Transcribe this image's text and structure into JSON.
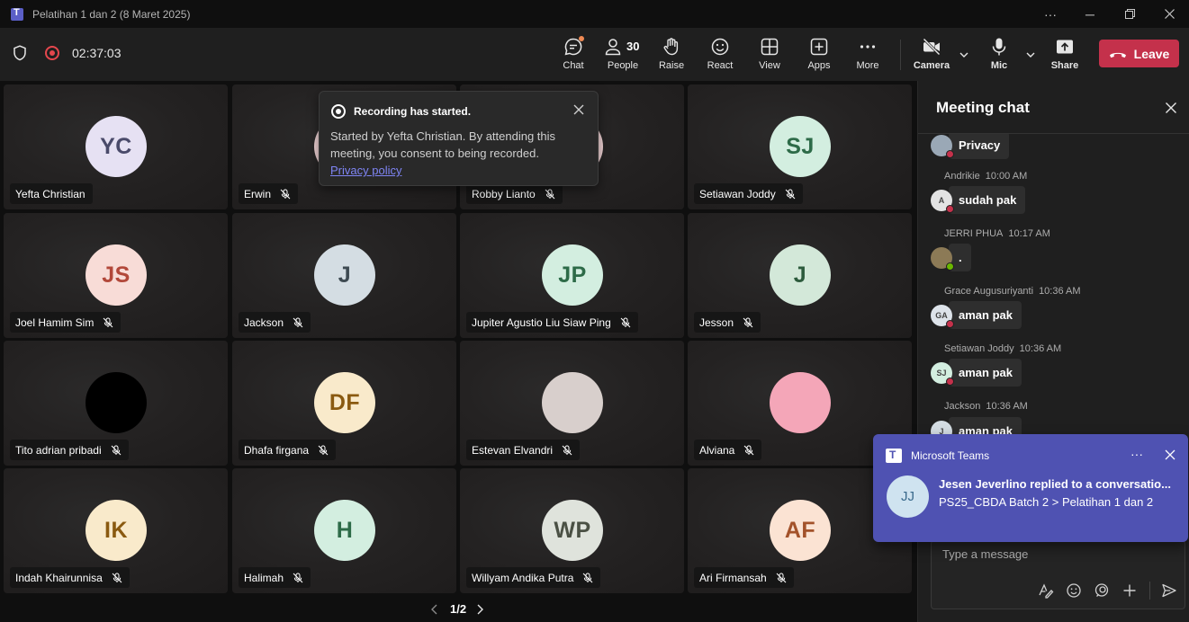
{
  "window": {
    "title": "Pelatihan 1 dan 2 (8 Maret 2025)"
  },
  "toolbar": {
    "timer": "02:37:03",
    "chat_label": "Chat",
    "people_label": "People",
    "people_count": "30",
    "raise_label": "Raise",
    "react_label": "React",
    "view_label": "View",
    "apps_label": "Apps",
    "more_label": "More",
    "camera_label": "Camera",
    "mic_label": "Mic",
    "share_label": "Share",
    "leave_label": "Leave"
  },
  "tiles": [
    {
      "initials": "YC",
      "name": "Yefta Christian",
      "muted": false,
      "bg": "#e6e1f3",
      "fg": "#4a4a6a"
    },
    {
      "initials": "",
      "name": "Erwin",
      "muted": true,
      "bg": "#f3d6d8",
      "fg": "#a4262c"
    },
    {
      "initials": "",
      "name": "Robby Lianto",
      "muted": true,
      "bg": "#f3d6d8",
      "fg": "#a4262c"
    },
    {
      "initials": "SJ",
      "name": "Setiawan Joddy",
      "muted": true,
      "bg": "#d3eee0",
      "fg": "#2d6b48"
    },
    {
      "initials": "JS",
      "name": "Joel Hamim Sim",
      "muted": true,
      "bg": "#f8dcd7",
      "fg": "#b2483a"
    },
    {
      "initials": "J",
      "name": "Jackson",
      "muted": true,
      "bg": "#d4dde3",
      "fg": "#3e4a52"
    },
    {
      "initials": "JP",
      "name": "Jupiter Agustio Liu Siaw Ping",
      "muted": true,
      "bg": "#d3eee0",
      "fg": "#2d6b48"
    },
    {
      "initials": "J",
      "name": "Jesson",
      "muted": true,
      "bg": "#d3e8d9",
      "fg": "#2d5b3d"
    },
    {
      "initials": "",
      "name": "Tito adrian pribadi",
      "muted": true,
      "bg": "#000000",
      "fg": "#ffffff"
    },
    {
      "initials": "DF",
      "name": "Dhafa firgana",
      "muted": true,
      "bg": "#f9eacb",
      "fg": "#8a5a10"
    },
    {
      "initials": "",
      "name": "Estevan Elvandri",
      "muted": true,
      "bg": "#d8cfcc",
      "fg": "#444444"
    },
    {
      "initials": "",
      "name": "Alviana",
      "muted": true,
      "bg": "#f4a6b8",
      "fg": "#444444"
    },
    {
      "initials": "IK",
      "name": "Indah Khairunnisa",
      "muted": true,
      "bg": "#f9eacb",
      "fg": "#8a5a10"
    },
    {
      "initials": "H",
      "name": "Halimah",
      "muted": true,
      "bg": "#d3eee0",
      "fg": "#2d6b48"
    },
    {
      "initials": "WP",
      "name": "Willyam Andika Putra",
      "muted": true,
      "bg": "#dfe3dc",
      "fg": "#4a5044"
    },
    {
      "initials": "AF",
      "name": "Ari Firmansah",
      "muted": true,
      "bg": "#fbe3d3",
      "fg": "#a3522a"
    }
  ],
  "recording_toast": {
    "title": "Recording has started.",
    "body": "Started by Yefta Christian. By attending this meeting, you consent to being recorded.",
    "link": "Privacy policy"
  },
  "pager": {
    "label": "1/2"
  },
  "chat": {
    "title": "Meeting chat",
    "messages": [
      {
        "sender": "",
        "time": "",
        "text": "Privacy",
        "avatar": "",
        "status": "#c4314b"
      },
      {
        "sender": "Andrikie",
        "time": "10:00 AM",
        "text": "sudah pak",
        "avatar": "A",
        "status": "#c4314b"
      },
      {
        "sender": "JERRI PHUA",
        "time": "10:17 AM",
        "text": ".",
        "avatar": "",
        "status": "#6bb700"
      },
      {
        "sender": "Grace Augusuriyanti",
        "time": "10:36 AM",
        "text": "aman pak",
        "avatar": "GA",
        "status": "#c4314b"
      },
      {
        "sender": "Setiawan Joddy",
        "time": "10:36 AM",
        "text": "aman pak",
        "avatar": "SJ",
        "status": "#c4314b"
      },
      {
        "sender": "Jackson",
        "time": "10:36 AM",
        "text": "aman pak",
        "avatar": "J",
        "status": "#c4314b"
      }
    ],
    "compose_placeholder": "Type a message"
  },
  "notification": {
    "app": "Microsoft Teams",
    "more": "···",
    "avatar": "JJ",
    "line1": "Jesen Jeverlino replied to a conversatio...",
    "line2": "PS25_CBDA Batch 2 > Pelatihan 1 dan 2"
  }
}
